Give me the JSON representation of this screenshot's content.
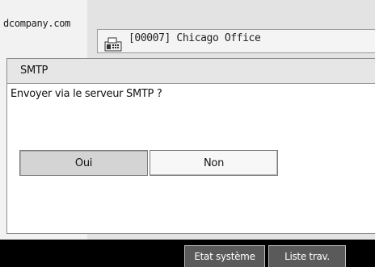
{
  "background": {
    "address_text": "dcompany.com",
    "destination": {
      "icon": "fax-machine-icon",
      "text": "[00007] Chicago Office"
    }
  },
  "dialog": {
    "title": "SMTP",
    "message": "Envoyer via le serveur SMTP ?",
    "buttons": {
      "yes": "Oui",
      "no": "Non"
    },
    "selected_button": "yes"
  },
  "statusbar": {
    "system_status": "Etat système",
    "job_list": "Liste trav."
  },
  "colors": {
    "selected_button": "#d4d4d4",
    "statusbar_bg": "#000000",
    "statusbar_button": "#5a5a5a"
  }
}
